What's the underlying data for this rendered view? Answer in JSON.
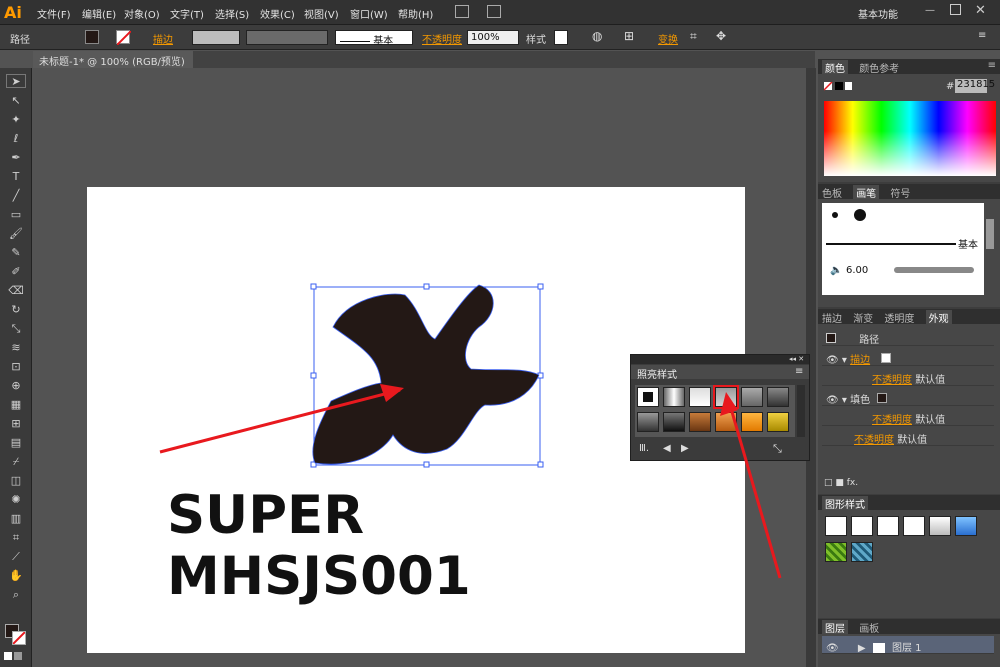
{
  "app": {
    "logo": "Ai",
    "workspace": "基本功能"
  },
  "menu": [
    "文件(F)",
    "编辑(E)",
    "对象(O)",
    "文字(T)",
    "选择(S)",
    "效果(C)",
    "视图(V)",
    "窗口(W)",
    "帮助(H)"
  ],
  "control": {
    "object_type": "路径",
    "stroke_label": "描边",
    "stroke_style": "基本",
    "opacity_label": "不透明度",
    "opacity_value": "100%",
    "style_label": "样式",
    "transform_label": "变换"
  },
  "document": {
    "tab_title": "未标题-1* @ 100% (RGB/预览)",
    "close": "×"
  },
  "artboard": {
    "text": "SUPER MHSJS001"
  },
  "color_panel": {
    "tabs": [
      "颜色",
      "颜色参考"
    ],
    "hex_label": "#",
    "hex_value": "231815"
  },
  "brush_panel": {
    "tabs": [
      "色板",
      "画笔",
      "符号"
    ],
    "basic_label": "基本",
    "size_value": "6.00"
  },
  "appearance_panel": {
    "tabs": [
      "描边",
      "渐变",
      "透明度",
      "外观"
    ],
    "title": "路径",
    "rows": [
      {
        "label": "描边",
        "value": ""
      },
      {
        "label": "不透明度",
        "value": "默认值"
      },
      {
        "label": "填色",
        "value": ""
      },
      {
        "label": "不透明度",
        "value": "默认值"
      },
      {
        "label": "不透明度",
        "value": "默认值"
      }
    ]
  },
  "graphic_styles_panel": {
    "title": "图形样式"
  },
  "layers_panel": {
    "tabs": [
      "图层",
      "画板"
    ],
    "layer_name": "图层 1"
  },
  "floating_panel": {
    "title": "照亮样式"
  },
  "colors": {
    "fill": "#231815",
    "accent": "#f39800",
    "arrow": "#e8191e"
  }
}
